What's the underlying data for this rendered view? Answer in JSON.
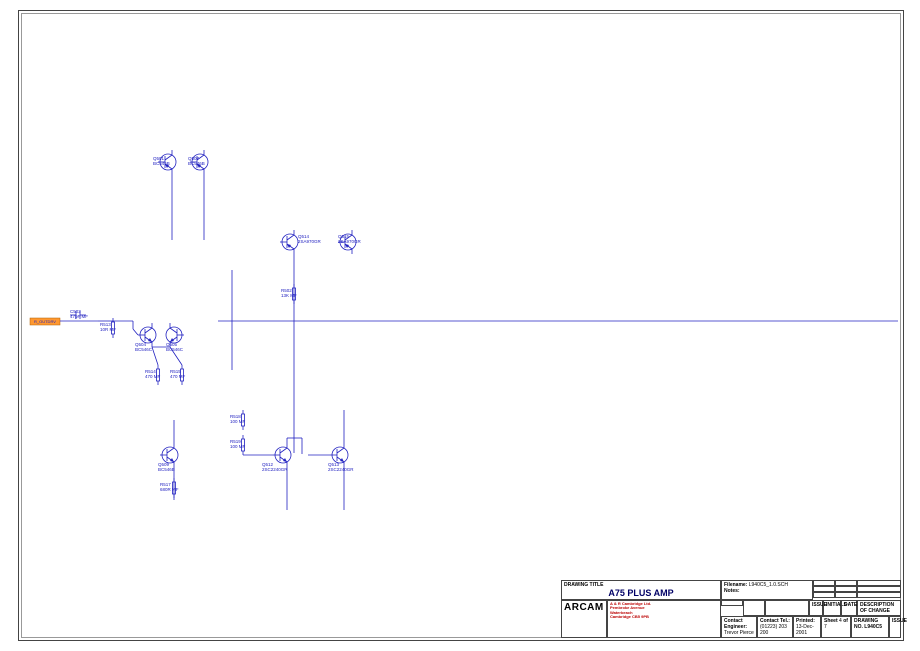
{
  "title_block": {
    "drawing_title_label": "DRAWING TITLE",
    "drawing_title": "A75 PLUS AMP",
    "filename_label": "Filename:",
    "filename": "L940C5_1.0.SCH",
    "notes_label": "Notes:",
    "brand": "ARCAM",
    "address_line1": "A & R Cambridge Ltd.",
    "address_line2": "Pembroke Avenue",
    "address_line3": "Waterbeach",
    "address_line4": "Cambridge CB5 9PB",
    "contact_eng_label": "Contact Engineer:",
    "contact_eng": "Trevor Pierce",
    "contact_tel_label": "Contact Tel.:",
    "contact_tel": "(01223) 203 200",
    "printed_label": "Printed:",
    "printed": "13-Dec-2001",
    "sheet_label": "Sheet",
    "sheet_of_label": "of",
    "sheet_num": "4",
    "sheet_total": "7",
    "drawing_no_label": "DRAWING NO.",
    "drawing_no": "L940C5",
    "issue_label": "ISSUE",
    "rev_hdr_issue": "ISSUE",
    "rev_hdr_initials": "INITIALS",
    "rev_hdr_date": "DATE",
    "rev_hdr_desc": "DESCRIPTION OF CHANGE"
  },
  "port": {
    "name": "R_OUTDRV"
  },
  "components": {
    "C503": {
      "ref": "C503",
      "val": "47pF MF"
    },
    "Q501": {
      "ref": "Q501",
      "val": "BC546B"
    },
    "Q507": {
      "ref": "Q507",
      "val": "BC546B"
    },
    "Q504": {
      "ref": "Q504",
      "val": "BC546C"
    },
    "Q505": {
      "ref": "Q505",
      "val": "BC546C"
    },
    "Q514": {
      "ref": "Q514",
      "val": "2SA970GR"
    },
    "Q515": {
      "ref": "Q515",
      "val": "2SA970GR"
    },
    "Q509": {
      "ref": "Q509",
      "val": "BC546B"
    },
    "Q512": {
      "ref": "Q512",
      "val": "2SC2240GR"
    },
    "Q513": {
      "ref": "Q513",
      "val": "2SC2240GR"
    },
    "R513": {
      "ref": "R513",
      "val": "10R MF"
    },
    "R514": {
      "ref": "R514",
      "val": "470 MF"
    },
    "R515": {
      "ref": "R515",
      "val": "470 MF"
    },
    "R502": {
      "ref": "R502",
      "val": "13K MF"
    },
    "R518": {
      "ref": "R518",
      "val": "100 MF"
    },
    "R519": {
      "ref": "R519",
      "val": "100 MF"
    },
    "R517": {
      "ref": "R517",
      "val": "680R MF"
    }
  }
}
